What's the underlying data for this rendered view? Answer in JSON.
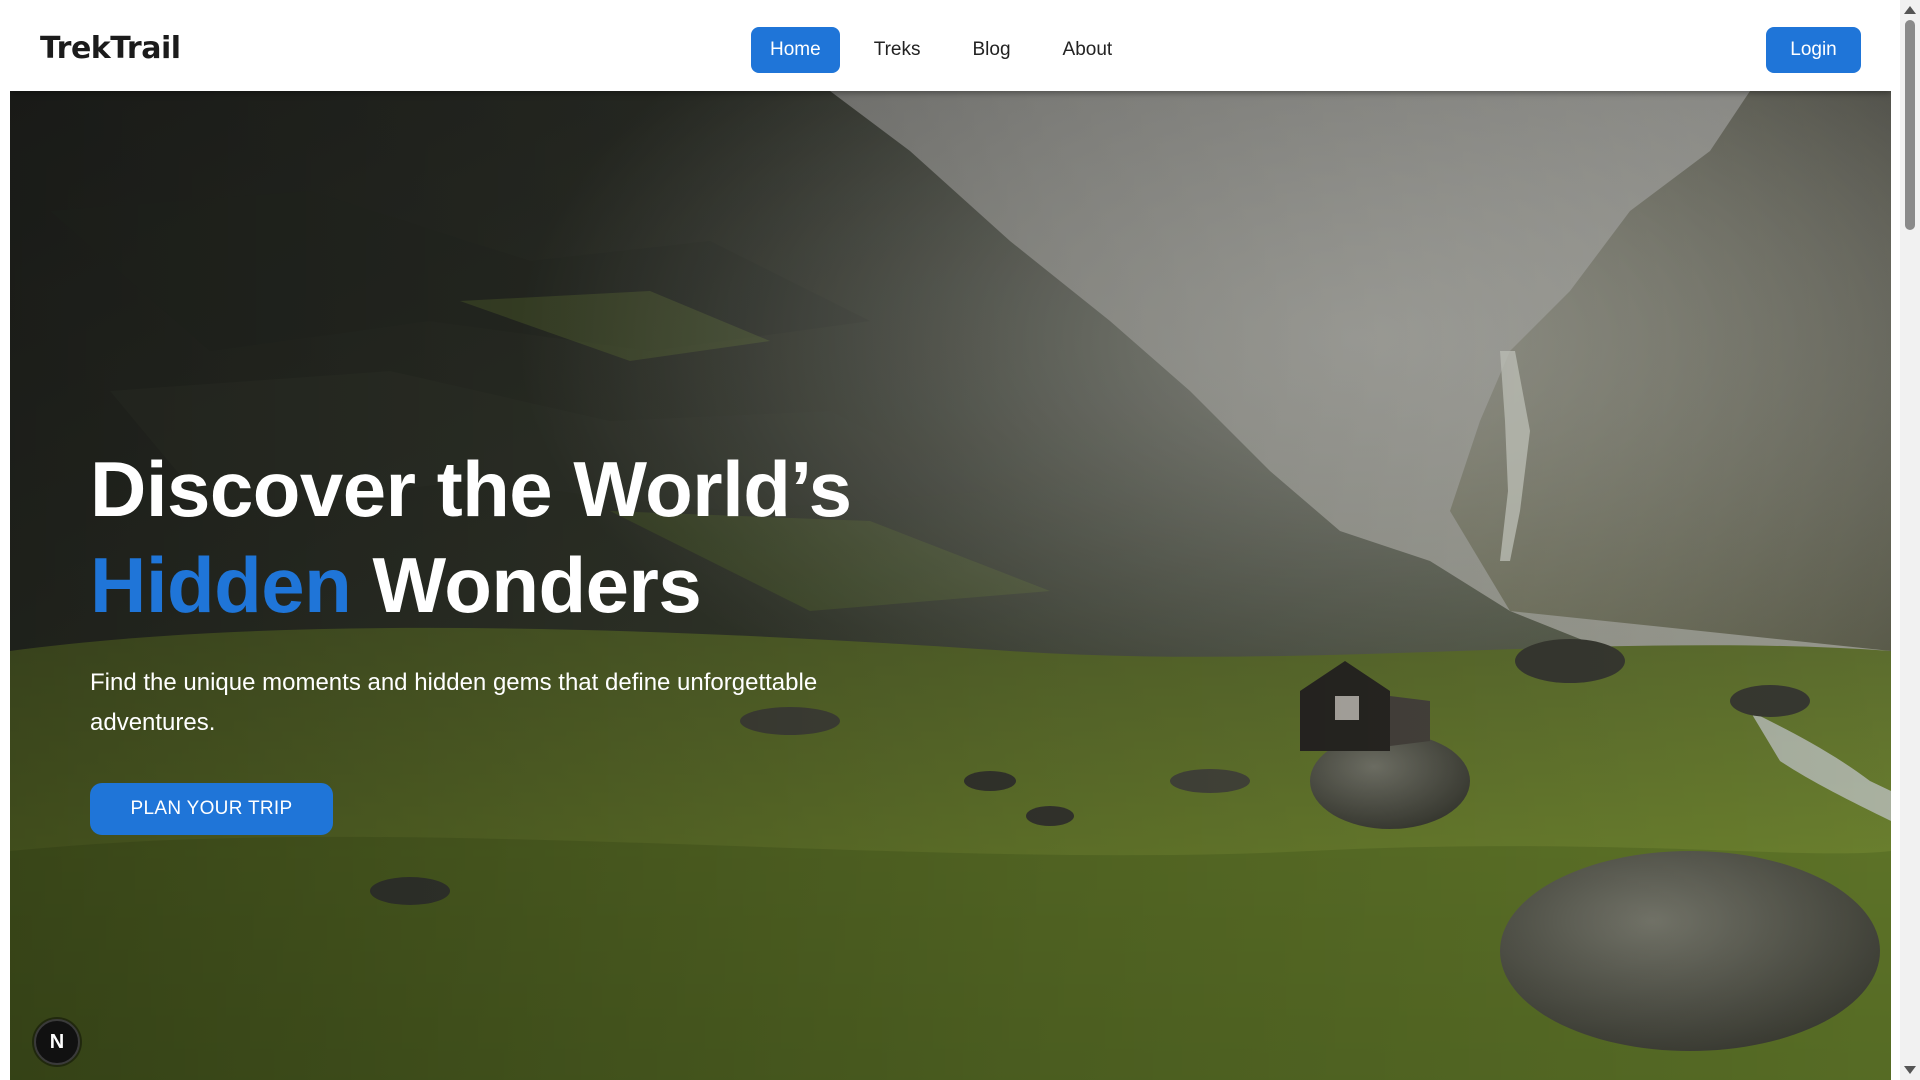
{
  "brand": {
    "name": "TrekTrail"
  },
  "nav": {
    "items": [
      {
        "label": "Home",
        "active": true
      },
      {
        "label": "Treks",
        "active": false
      },
      {
        "label": "Blog",
        "active": false
      },
      {
        "label": "About",
        "active": false
      }
    ],
    "login_label": "Login"
  },
  "hero": {
    "title_line1": "Discover the World’s",
    "title_accent": "Hidden",
    "title_rest": " Wonders",
    "subtitle": "Find the unique moments and hidden gems that define unforgettable adventures.",
    "cta_label": "PLAN YOUR TRIP"
  },
  "dev_badge": {
    "label": "N"
  },
  "colors": {
    "accent": "#1f75d8",
    "nav_background": "#ffffff",
    "hero_text": "#ffffff"
  },
  "icons": {
    "dev_badge": "nextjs-icon",
    "scroll_up": "scroll-up-arrow-icon",
    "scroll_down": "scroll-down-arrow-icon"
  }
}
